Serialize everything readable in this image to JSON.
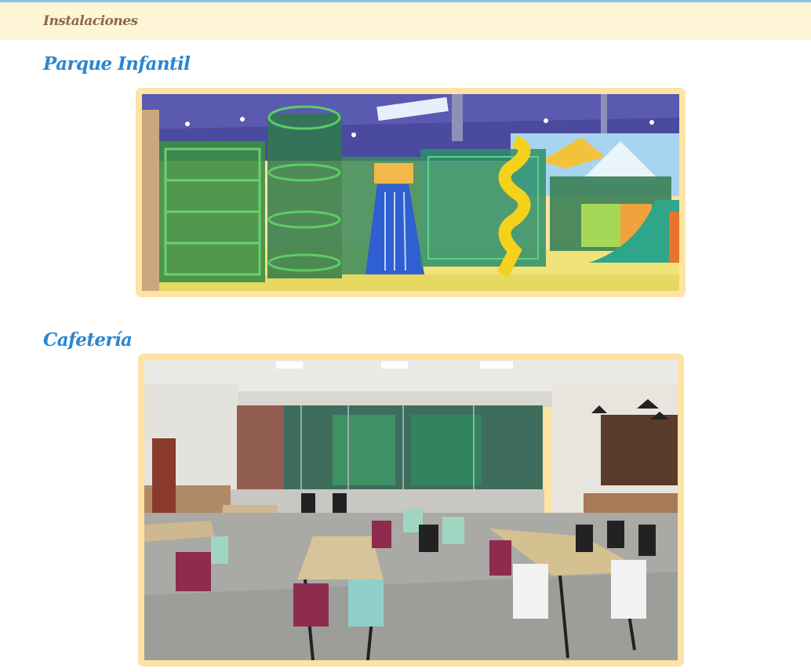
{
  "header": {
    "breadcrumb": "Instalaciones"
  },
  "sections": [
    {
      "title": "Parque Infantil",
      "image_subject": "indoor-playground-photo"
    },
    {
      "title": "Cafetería",
      "image_subject": "cafeteria-photo"
    }
  ],
  "colors": {
    "header_bg": "#fdf5d6",
    "header_border": "#8ec3e6",
    "breadcrumb_text": "#8a6a48",
    "section_title": "#2b86cf",
    "frame": "#fde3a4"
  }
}
